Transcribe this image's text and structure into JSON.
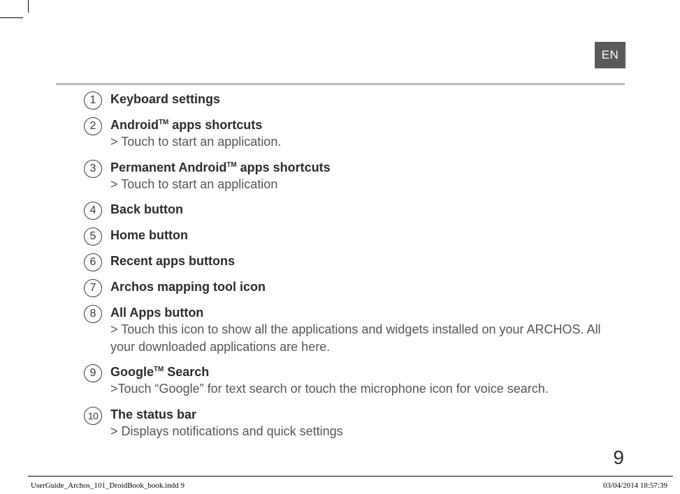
{
  "lang_tab": "EN",
  "page_number": "9",
  "footer": {
    "file": "UserGuide_Archos_101_DroidBook_book.indd   9",
    "stamp": "03/04/2014   18:57:39"
  },
  "items": [
    {
      "n": "1",
      "title_pre": "Keyboard settings",
      "tm": "",
      "title_post": "",
      "desc_pre": "",
      "desc_post": ""
    },
    {
      "n": "2",
      "title_pre": "Android",
      "tm": "TM",
      "title_post": " apps shortcuts",
      "desc_pre": "> ",
      "desc_post": "Touch to start an application."
    },
    {
      "n": "3",
      "title_pre": "Permanent Android",
      "tm": "TM",
      "title_post": " apps shortcuts",
      "desc_pre": "> ",
      "desc_post": "Touch to start an application"
    },
    {
      "n": "4",
      "title_pre": "Back button",
      "tm": "",
      "title_post": "",
      "desc_pre": "",
      "desc_post": ""
    },
    {
      "n": "5",
      "title_pre": "Home button",
      "tm": "",
      "title_post": "",
      "desc_pre": "",
      "desc_post": ""
    },
    {
      "n": "6",
      "title_pre": "Recent apps buttons",
      "tm": "",
      "title_post": "",
      "desc_pre": "",
      "desc_post": ""
    },
    {
      "n": "7",
      "title_pre": "Archos mapping tool icon",
      "tm": "",
      "title_post": "",
      "desc_pre": "",
      "desc_post": ""
    },
    {
      "n": "8",
      "title_pre": "All Apps button",
      "tm": "",
      "title_post": "",
      "desc_pre": "> ",
      "desc_post": "Touch this icon to show all the applications and widgets installed on your ARCHOS. All your downloaded applications are here."
    },
    {
      "n": "9",
      "title_pre": "Google",
      "tm": "TM",
      "title_post": " Search",
      "desc_pre": ">",
      "desc_post": "Touch “Google” for text search or touch the microphone icon for voice search."
    },
    {
      "n": "10",
      "title_pre": "The status bar",
      "tm": "",
      "title_post": "",
      "desc_pre": "> ",
      "desc_post": "Displays notifications and quick settings"
    }
  ]
}
